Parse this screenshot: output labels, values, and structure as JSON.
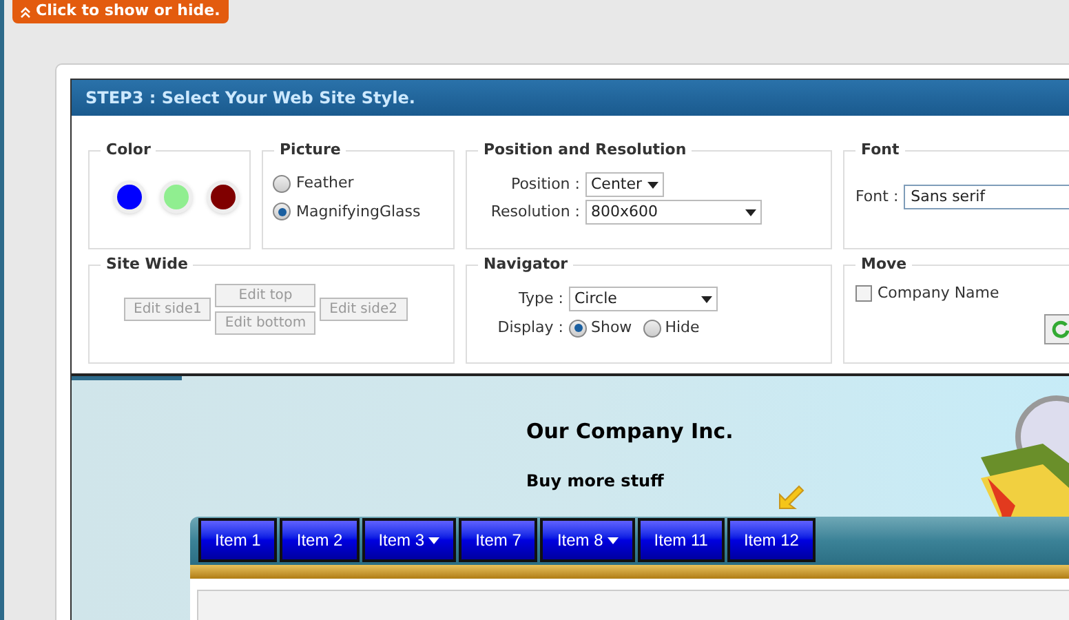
{
  "toggle_tab": {
    "label": "Click to show or hide."
  },
  "panel": {
    "title": "STEP3 : Select Your Web Site Style."
  },
  "color": {
    "legend": "Color",
    "swatches": [
      {
        "color": "#0000ff"
      },
      {
        "color": "#90ee90"
      },
      {
        "color": "#800000"
      }
    ]
  },
  "picture": {
    "legend": "Picture",
    "options": [
      {
        "label": "Feather",
        "selected": false
      },
      {
        "label": "MagnifyingGlass",
        "selected": true
      }
    ]
  },
  "position": {
    "legend": "Position and Resolution",
    "fields": [
      {
        "label": "Position :",
        "value": "Center"
      },
      {
        "label": "Resolution :",
        "value": "800x600"
      }
    ]
  },
  "font": {
    "legend": "Font",
    "label": "Font :",
    "value": "Sans serif"
  },
  "site_wide": {
    "legend": "Site Wide",
    "buttons": [
      "Edit side1",
      "Edit top",
      "Edit bottom",
      "Edit side2"
    ]
  },
  "navigator": {
    "legend": "Navigator",
    "type_label": "Type :",
    "type_value": "Circle",
    "display_label": "Display :",
    "options": [
      {
        "label": "Show",
        "selected": true
      },
      {
        "label": "Hide",
        "selected": false
      }
    ]
  },
  "move": {
    "legend": "Move",
    "checkbox": {
      "label": "Company Name",
      "checked": false
    }
  },
  "preview": {
    "title": "Our Company Inc.",
    "subtitle": "Buy more stuff",
    "menu": [
      {
        "label": "Item 1",
        "dropdown": false
      },
      {
        "label": "Item 2",
        "dropdown": false
      },
      {
        "label": "Item 3",
        "dropdown": true
      },
      {
        "label": "Item 7",
        "dropdown": false
      },
      {
        "label": "Item 8",
        "dropdown": true
      },
      {
        "label": "Item 11",
        "dropdown": false
      },
      {
        "label": "Item 12",
        "dropdown": false
      }
    ]
  }
}
